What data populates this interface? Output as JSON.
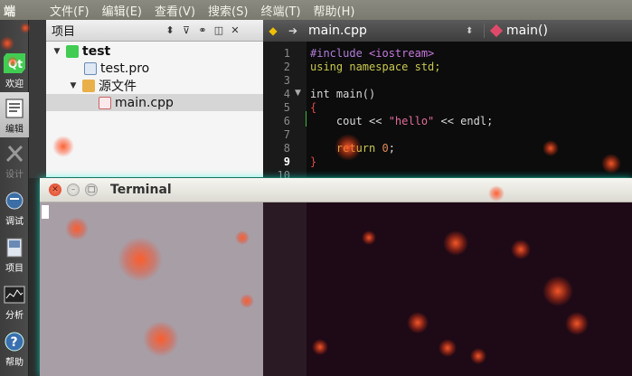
{
  "menubar": {
    "app": "端",
    "menus": [
      "文件(F)",
      "编辑(E)",
      "查看(V)",
      "搜索(S)",
      "终端(T)",
      "帮助(H)"
    ]
  },
  "modebar": {
    "modes": [
      {
        "label": "欢迎",
        "icon": "qt-logo-icon"
      },
      {
        "label": "编辑",
        "icon": "edit-document-icon"
      },
      {
        "label": "设计",
        "icon": "design-tools-icon"
      },
      {
        "label": "调试",
        "icon": "debug-bug-icon"
      },
      {
        "label": "项目",
        "icon": "project-book-icon"
      },
      {
        "label": "分析",
        "icon": "analyze-chart-icon"
      },
      {
        "label": "帮助",
        "icon": "help-icon"
      }
    ]
  },
  "project_panel": {
    "title": "项目",
    "tree": [
      {
        "label": "test",
        "icon": "qt-project-icon"
      },
      {
        "label": "test.pro",
        "icon": "pro-file-icon"
      },
      {
        "label": "源文件",
        "icon": "source-folder-icon"
      },
      {
        "label": "main.cpp",
        "icon": "cpp-file-icon"
      }
    ]
  },
  "editor": {
    "filename": "main.cpp",
    "symbol": "main()",
    "line_numbers": [
      "1",
      "2",
      "3",
      "4",
      "5",
      "6",
      "7",
      "8",
      "9",
      "10"
    ],
    "lines": {
      "l1a": "#include ",
      "l1b": "<iostream>",
      "l2": "using namespace std;",
      "l4": "int main()",
      "l5": "{",
      "l6a": "    cout << ",
      "l6b": "\"hello\"",
      "l6c": " << endl;",
      "l8a": "    return ",
      "l8b": "0",
      "l8c": ";",
      "l9": "}"
    }
  },
  "terminal": {
    "title": "Terminal"
  },
  "colors": {
    "accent_glow": "#00ffdc",
    "string": "#e06c9a",
    "keyword": "#c8c850"
  }
}
